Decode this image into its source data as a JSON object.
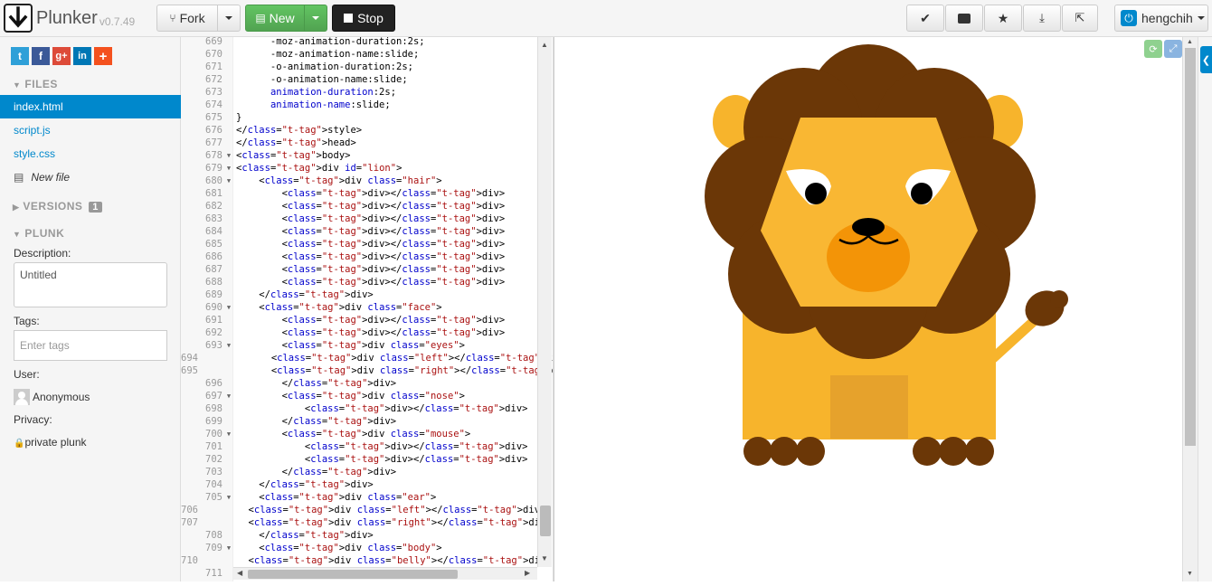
{
  "brand": {
    "name": "Plunker",
    "version": "v0.7.49"
  },
  "toolbar": {
    "fork_label": "Fork",
    "new_label": "New",
    "stop_label": "Stop",
    "user_label": "hengchih"
  },
  "sidebar": {
    "files_heading": "FILES",
    "files": [
      {
        "label": "index.html"
      },
      {
        "label": "script.js"
      },
      {
        "label": "style.css"
      }
    ],
    "new_file_label": "New file",
    "versions_heading": "VERSIONS",
    "versions_count": "1",
    "plunk_heading": "PLUNK",
    "description_label": "Description:",
    "description_value": "Untitled",
    "tags_label": "Tags:",
    "tags_placeholder": "Enter tags",
    "user_label": "User:",
    "user_name": "Anonymous",
    "privacy_label": "Privacy:",
    "privacy_value": "private plunk"
  },
  "editor": {
    "lines": [
      {
        "n": "669",
        "fold": false,
        "indent": 6,
        "text": "-moz-animation-duration:2s;"
      },
      {
        "n": "670",
        "fold": false,
        "indent": 6,
        "text": "-moz-animation-name:slide;"
      },
      {
        "n": "671",
        "fold": false,
        "indent": 6,
        "text": "-o-animation-duration:2s;"
      },
      {
        "n": "672",
        "fold": false,
        "indent": 6,
        "text": "-o-animation-name:slide;"
      },
      {
        "n": "673",
        "fold": false,
        "indent": 6,
        "text": "animation-duration:2s;",
        "prop": true
      },
      {
        "n": "674",
        "fold": false,
        "indent": 6,
        "text": "animation-name:slide;",
        "prop": true
      },
      {
        "n": "675",
        "fold": false,
        "indent": 0,
        "text": "}"
      },
      {
        "n": "676",
        "fold": false,
        "indent": 0,
        "text": "</style>",
        "tag": true
      },
      {
        "n": "677",
        "fold": false,
        "indent": 0,
        "text": "</head>",
        "tag": true
      },
      {
        "n": "678",
        "fold": true,
        "indent": 0,
        "text": "<body>",
        "tag": true
      },
      {
        "n": "679",
        "fold": true,
        "indent": 0,
        "text": "<div id=\"lion\">",
        "tag": true
      },
      {
        "n": "680",
        "fold": true,
        "indent": 4,
        "text": "<div class=\"hair\">",
        "tag": true
      },
      {
        "n": "681",
        "fold": false,
        "indent": 8,
        "text": "<div></div>",
        "tag": true
      },
      {
        "n": "682",
        "fold": false,
        "indent": 8,
        "text": "<div></div>",
        "tag": true
      },
      {
        "n": "683",
        "fold": false,
        "indent": 8,
        "text": "<div></div>",
        "tag": true
      },
      {
        "n": "684",
        "fold": false,
        "indent": 8,
        "text": "<div></div>",
        "tag": true
      },
      {
        "n": "685",
        "fold": false,
        "indent": 8,
        "text": "<div></div>",
        "tag": true
      },
      {
        "n": "686",
        "fold": false,
        "indent": 8,
        "text": "<div></div>",
        "tag": true
      },
      {
        "n": "687",
        "fold": false,
        "indent": 8,
        "text": "<div></div>",
        "tag": true
      },
      {
        "n": "688",
        "fold": false,
        "indent": 8,
        "text": "<div></div>",
        "tag": true
      },
      {
        "n": "689",
        "fold": false,
        "indent": 4,
        "text": "</div>",
        "tag": true
      },
      {
        "n": "690",
        "fold": true,
        "indent": 4,
        "text": "<div class=\"face\">",
        "tag": true
      },
      {
        "n": "691",
        "fold": false,
        "indent": 8,
        "text": "<div></div>",
        "tag": true
      },
      {
        "n": "692",
        "fold": false,
        "indent": 8,
        "text": "<div></div>",
        "tag": true
      },
      {
        "n": "693",
        "fold": true,
        "indent": 8,
        "text": "<div class=\"eyes\">",
        "tag": true
      },
      {
        "n": "694",
        "fold": false,
        "indent": 12,
        "text": "<div class=\"left\"></div>",
        "tag": true
      },
      {
        "n": "695",
        "fold": false,
        "indent": 12,
        "text": "<div class=\"right\"></div>",
        "tag": true
      },
      {
        "n": "696",
        "fold": false,
        "indent": 8,
        "text": "</div>",
        "tag": true
      },
      {
        "n": "697",
        "fold": true,
        "indent": 8,
        "text": "<div class=\"nose\">",
        "tag": true
      },
      {
        "n": "698",
        "fold": false,
        "indent": 12,
        "text": "<div></div>",
        "tag": true
      },
      {
        "n": "699",
        "fold": false,
        "indent": 8,
        "text": "</div>",
        "tag": true
      },
      {
        "n": "700",
        "fold": true,
        "indent": 8,
        "text": "<div class=\"mouse\">",
        "tag": true
      },
      {
        "n": "701",
        "fold": false,
        "indent": 12,
        "text": "<div></div>",
        "tag": true
      },
      {
        "n": "702",
        "fold": false,
        "indent": 12,
        "text": "<div></div>",
        "tag": true
      },
      {
        "n": "703",
        "fold": false,
        "indent": 8,
        "text": "</div>",
        "tag": true
      },
      {
        "n": "704",
        "fold": false,
        "indent": 4,
        "text": "</div>",
        "tag": true
      },
      {
        "n": "705",
        "fold": true,
        "indent": 4,
        "text": "<div class=\"ear\">",
        "tag": true
      },
      {
        "n": "706",
        "fold": false,
        "indent": 8,
        "text": "<div class=\"left\"></div>",
        "tag": true
      },
      {
        "n": "707",
        "fold": false,
        "indent": 8,
        "text": "<div class=\"right\"></div>",
        "tag": true
      },
      {
        "n": "708",
        "fold": false,
        "indent": 4,
        "text": "</div>",
        "tag": true
      },
      {
        "n": "709",
        "fold": true,
        "indent": 4,
        "text": "<div class=\"body\">",
        "tag": true
      },
      {
        "n": "710",
        "fold": false,
        "indent": 8,
        "text": "<div class=\"belly\"></div>",
        "tag": true
      },
      {
        "n": "711",
        "fold": false,
        "indent": 8,
        "text": "",
        "tag": false
      }
    ]
  },
  "colors": {
    "mane": "#6b3707",
    "fur": "#f7b42c",
    "face": "#f9b733",
    "muzzle": "#f39407",
    "belly": "#e6a22c",
    "accent": "#0088cc",
    "new_green": "#5bb75b"
  }
}
